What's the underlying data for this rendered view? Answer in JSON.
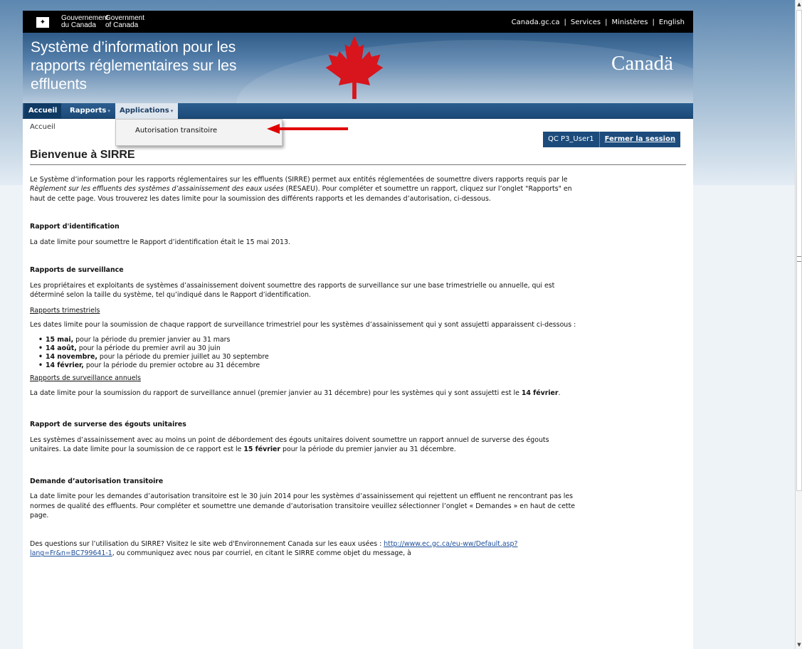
{
  "fip": {
    "gov_fr": "Gouvernement\ndu Canada",
    "gov_fr_line1": "Gouvernement",
    "gov_fr_line2": "du Canada",
    "gov_en_line1": "Government",
    "gov_en_line2": "of Canada",
    "links": [
      "Canada.gc.ca",
      "Services",
      "Ministères",
      "English"
    ]
  },
  "banner": {
    "title_line1": "Système d’information pour les",
    "title_line2": "rapports réglementaires sur les",
    "title_line3": "effluents",
    "wordmark": "Canadä"
  },
  "nav": {
    "accueil": "Accueil",
    "rapports": "Rapports",
    "applications": "Applications",
    "caret": "▾",
    "dropdown_item": "Autorisation transitoire"
  },
  "breadcrumb": "Accueil",
  "session": {
    "user": "QC P3_User1",
    "logout": "Fermer la session"
  },
  "content": {
    "title": "Bienvenue à SIRRE",
    "intro_pre": "Le Système d’information pour les rapports réglementaires sur les effluents (SIRRE) permet aux entités réglementées de soumettre divers rapports requis par le ",
    "intro_em": "Règlement sur les effluents des systèmes d’assainissement des eaux usées",
    "intro_post": " (RESAEU). Pour compléter et soumettre un rapport, cliquez sur l’onglet \"Rapports\" en haut de cette page. Vous trouverez les dates limite pour la soumission des différents rapports et les demandes d’autorisation, ci-dessous.",
    "s1_head": "Rapport d'identification",
    "s1_text": "La date limite pour soumettre le Rapport d’identification était le 15 mai 2013.",
    "s2_head": "Rapports de surveillance",
    "s2_text": "Les propriétaires et exploitants de systèmes d’assainissement doivent soumettre des rapports de surveillance sur une base trimestrielle ou annuelle, qui est déterminé selon la taille du système, tel qu’indiqué dans le Rapport d’identification.",
    "s2_sub1": "Rapports trimestriels",
    "s2_sub1_text": "Les dates limite pour la soumission de chaque rapport de surveillance trimestriel pour les systèmes d’assainissement qui y sont assujetti apparaissent ci-dessous :",
    "bullets": [
      {
        "bold": "15 mai,",
        "rest": " pour la période du premier janvier au 31 mars"
      },
      {
        "bold": "14 août,",
        "rest": " pour la période du premier avril au 30 juin"
      },
      {
        "bold": "14 novembre,",
        "rest": " pour la période du premier juillet au 30 septembre"
      },
      {
        "bold": "14 février,",
        "rest": " pour la période du premier octobre au 31 décembre"
      }
    ],
    "s2_sub2": "Rapports de surveillance annuels",
    "s2_sub2_pre": "La date limite pour la soumission du rapport de surveillance annuel (premier janvier au 31 décembre) pour les systèmes qui y sont assujetti est le ",
    "s2_sub2_bold": "14 février",
    "s2_sub2_post": ".",
    "s3_head": "Rapport de surverse des égouts unitaires",
    "s3_pre": "Les systèmes d’assainissement avec au moins un point de débordement des égouts unitaires doivent soumettre un rapport annuel de surverse des égouts unitaires. La date limite pour la soumission de ce rapport est le ",
    "s3_bold": "15 février",
    "s3_post": " pour la période du premier janvier au 31 décembre.",
    "s4_head": "Demande d’autorisation transitoire",
    "s4_text": "La date limite pour les demandes d’autorisation transitoire est le 30 juin 2014 pour les systèmes d’assainissement qui rejettent un effluent ne rencontrant pas les normes de qualité des effluents. Pour compléter et soumettre une demande d’autorisation transitoire veuillez sélectionner l’onglet « Demandes » en haut de cette page.",
    "footer_pre": "Des questions sur l’utilisation du SIRRE? Visitez le site web d'Environnement Canada sur les eaux usées : ",
    "footer_link": "http://www.ec.gc.ca/eu-ww/Default.asp?lang=Fr&n=BC799641-1",
    "footer_post": ", ou communiquez avec nous par courriel, en citant le SIRRE comme objet du message, à"
  },
  "colors": {
    "nav_bg": "#1b4a78",
    "session_bg": "#1c4b7c",
    "annotation_arrow": "#e00000"
  },
  "icons": [
    "canada-flag-icon",
    "maple-leaf-icon",
    "caret-down-icon",
    "red-arrow-annotation"
  ]
}
